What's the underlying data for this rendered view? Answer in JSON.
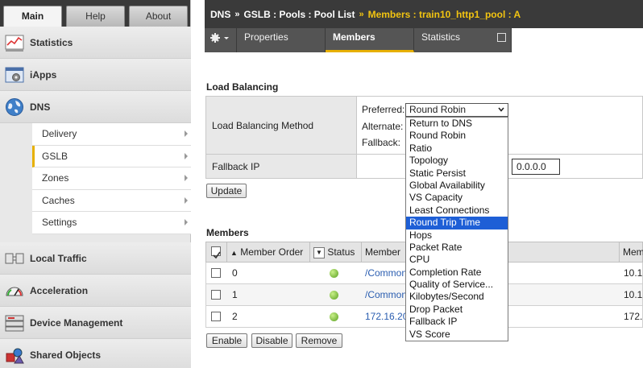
{
  "top_tabs": {
    "main": "Main",
    "help": "Help",
    "about": "About"
  },
  "sidebar": {
    "sections": [
      {
        "label": "Statistics",
        "icon": "statistics-icon"
      },
      {
        "label": "iApps",
        "icon": "iapps-icon"
      },
      {
        "label": "DNS",
        "icon": "globe-icon"
      },
      {
        "label": "Local Traffic",
        "icon": "local-traffic-icon"
      },
      {
        "label": "Acceleration",
        "icon": "speedometer-icon"
      },
      {
        "label": "Device Management",
        "icon": "server-icon"
      },
      {
        "label": "Shared Objects",
        "icon": "shapes-icon"
      }
    ],
    "dns_items": [
      "Delivery",
      "GSLB",
      "Zones",
      "Caches",
      "Settings"
    ]
  },
  "header": {
    "crumb1": "DNS",
    "crumb2": "GSLB : Pools : Pool List",
    "sep": "»",
    "current": "Members : train10_http1_pool : A"
  },
  "subtabs": {
    "properties": "Properties",
    "members": "Members",
    "statistics": "Statistics"
  },
  "load_balancing": {
    "title": "Load Balancing",
    "method_label": "Load Balancing Method",
    "preferred_label": "Preferred:",
    "alternate_label": "Alternate:",
    "fallback_label": "Fallback:",
    "preferred_value": "Round Robin",
    "fallback_ip_label": "Fallback IP",
    "fallback_ip_value": "0.0.0.0",
    "update_button": "Update"
  },
  "dropdown": {
    "options": [
      "Return to DNS",
      "Round Robin",
      "Ratio",
      "Topology",
      "Static Persist",
      "Global Availability",
      "VS Capacity",
      "Least Connections",
      "Round Trip Time",
      "Hops",
      "Packet Rate",
      "CPU",
      "Completion Rate",
      "Quality of Service...",
      "Kilobytes/Second",
      "Drop Packet",
      "Fallback IP",
      "VS Score"
    ],
    "highlighted": "Round Trip Time"
  },
  "members": {
    "title": "Members",
    "columns": {
      "order": "Member Order",
      "status": "Status",
      "member": "Member",
      "mem": "Mem"
    },
    "rows": [
      {
        "order": "0",
        "member": "/Common",
        "ip": "10.1"
      },
      {
        "order": "1",
        "member": "/Common",
        "ip": "10.1"
      },
      {
        "order": "2",
        "member": "172.16.20",
        "ip": "172.1"
      }
    ],
    "buttons": {
      "enable": "Enable",
      "disable": "Disable",
      "remove": "Remove"
    }
  },
  "colors": {
    "accent": "#e7b000",
    "header_bg": "#3a3a3a",
    "highlight": "#1e5fd6",
    "link": "#2a5db0",
    "status_ok": "#5aa020"
  }
}
